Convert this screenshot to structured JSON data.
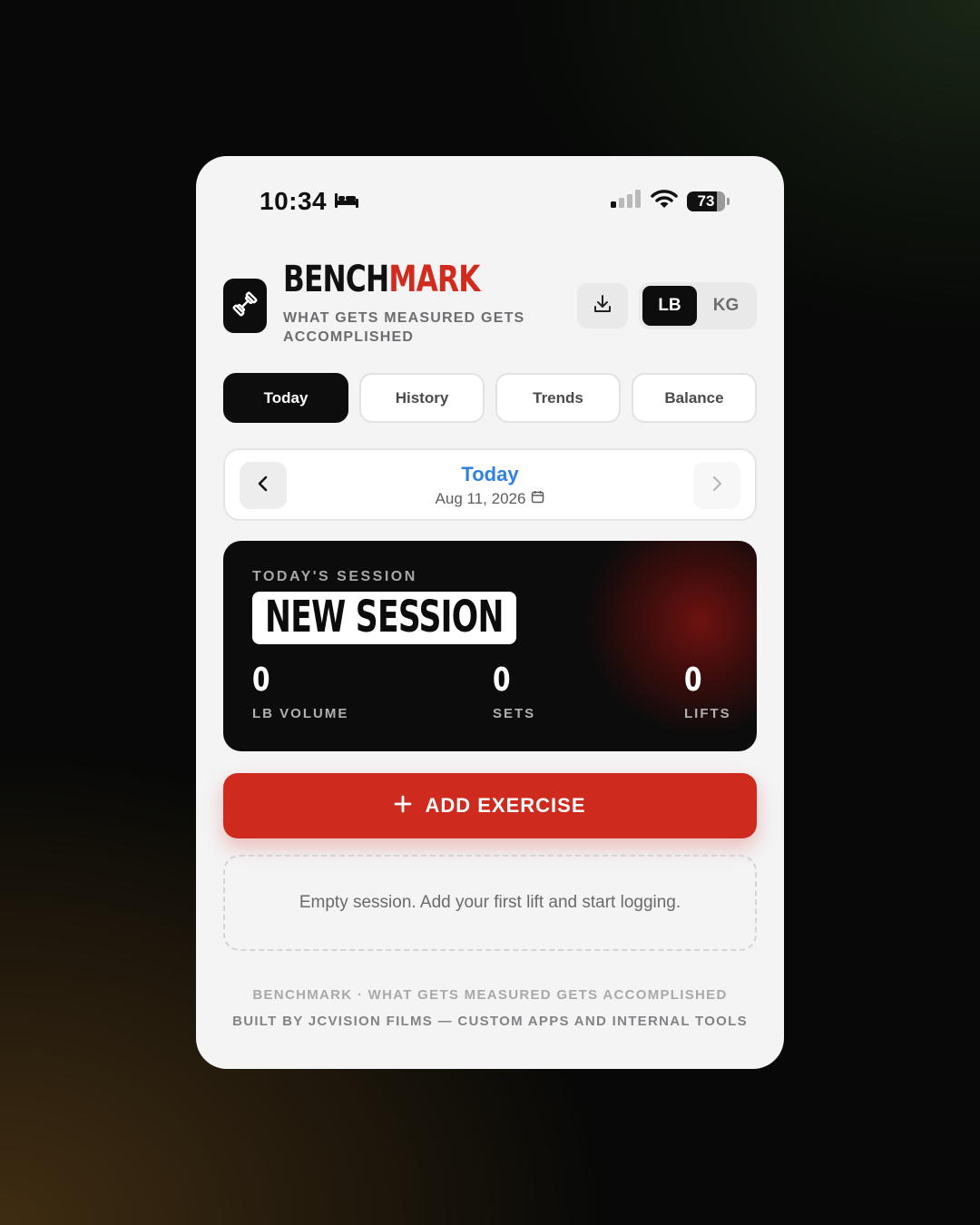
{
  "status": {
    "time": "10:34",
    "battery": "73"
  },
  "header": {
    "brand_part1": "BENCH",
    "brand_part2": "MARK",
    "tagline": "WHAT GETS MEASURED GETS ACCOMPLISHED",
    "units": [
      "LB",
      "KG"
    ],
    "selected_unit": "LB"
  },
  "tabs": [
    {
      "label": "Today",
      "active": true
    },
    {
      "label": "History",
      "active": false
    },
    {
      "label": "Trends",
      "active": false
    },
    {
      "label": "Balance",
      "active": false
    }
  ],
  "date_nav": {
    "title": "Today",
    "date": "Aug 11, 2026"
  },
  "session": {
    "label": "TODAY'S SESSION",
    "name": "NEW SESSION",
    "stats": [
      {
        "value": "0",
        "label": "LB VOLUME"
      },
      {
        "value": "0",
        "label": "SETS"
      },
      {
        "value": "0",
        "label": "LIFTS"
      }
    ]
  },
  "add_exercise": {
    "label": "ADD EXERCISE"
  },
  "empty_message": "Empty session. Add your first lift and start logging.",
  "footer": {
    "line1": "BENCHMARK · WHAT GETS MEASURED GETS ACCOMPLISHED",
    "line2": "BUILT BY JCVISION FILMS — CUSTOM APPS AND INTERNAL TOOLS"
  },
  "colors": {
    "accent": "#cf2a1e",
    "link": "#2f82e3",
    "dark": "#0c0c0c"
  },
  "icons": {
    "sleep": "bed-icon",
    "signal": "cellular-signal-icon",
    "wifi": "wifi-icon",
    "logo": "dumbbell-icon",
    "download": "download-icon",
    "prev": "chevron-left-icon",
    "next": "chevron-right-icon",
    "calendar": "calendar-icon",
    "add": "plus-icon"
  }
}
